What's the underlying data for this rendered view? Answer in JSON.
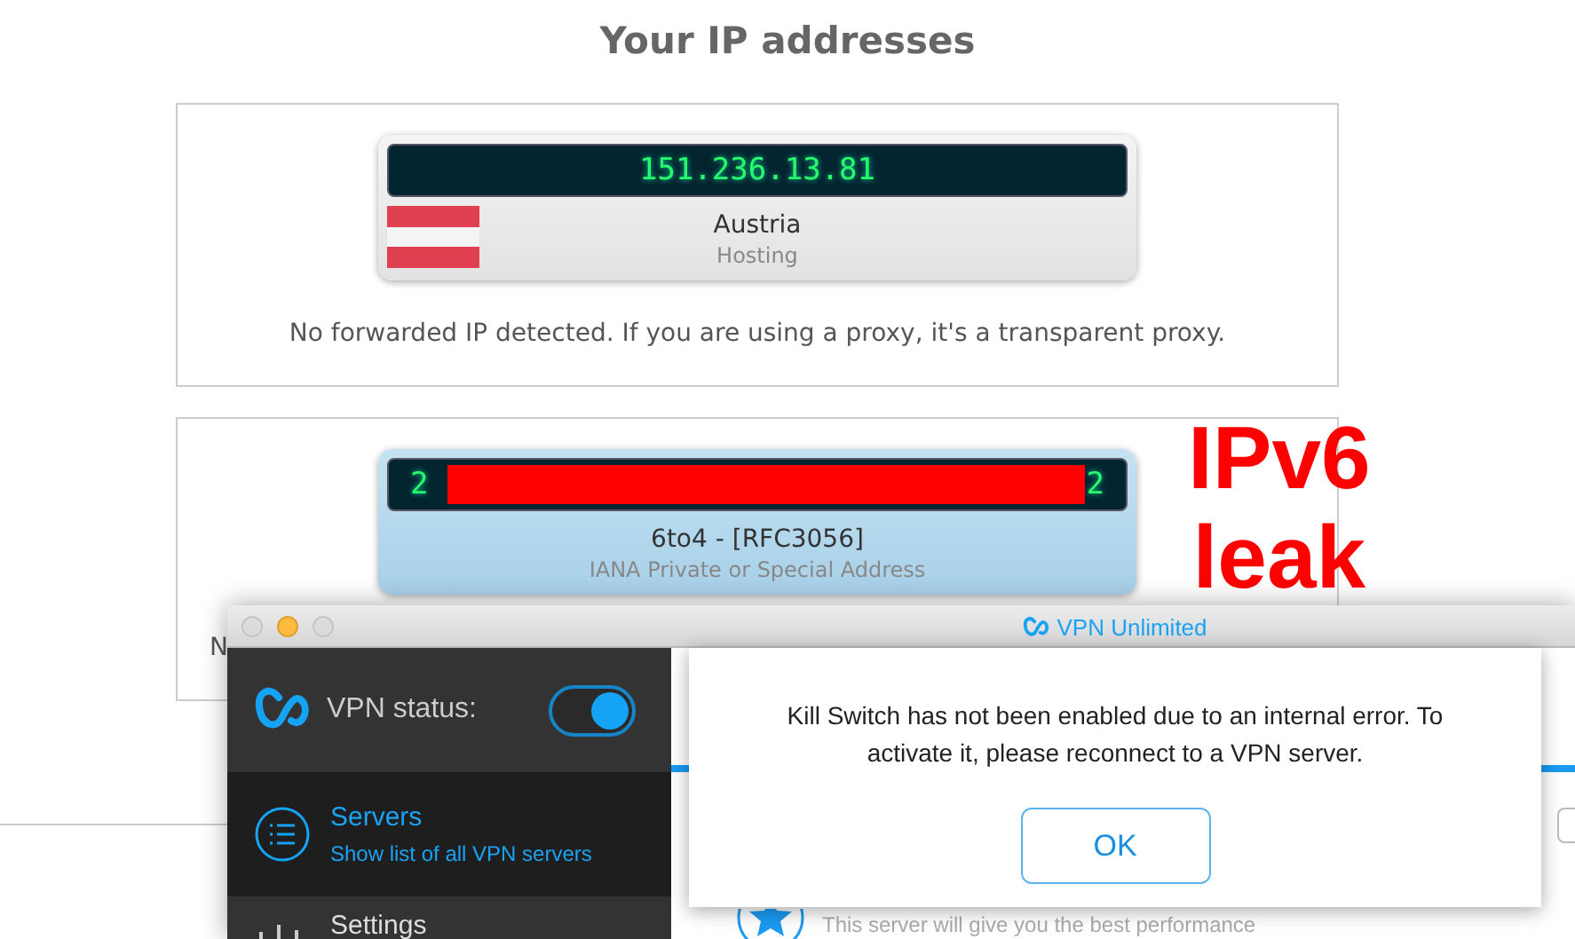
{
  "page": {
    "title": "Your IP addresses"
  },
  "addresses": [
    {
      "ip": "151.236.13.81",
      "redacted": false,
      "flag": true,
      "country": "Austria",
      "type": "Hosting",
      "highlighted": false,
      "note": "No forwarded IP detected. If you are using a proxy, it's a transparent proxy."
    },
    {
      "ip_start": "2",
      "ip_end": "2",
      "redacted": true,
      "country": "6to4 - [RFC3056]",
      "type": "IANA Private or Special Address",
      "highlighted": true,
      "note": "N"
    }
  ],
  "annotation": {
    "lines": [
      "IPv6",
      "leak"
    ]
  },
  "vpn_window": {
    "title": "VPN Unlimited",
    "status_label": "VPN status:",
    "vpn_on": true,
    "menu": [
      {
        "kind": "servers",
        "title": "Servers",
        "subtitle": "Show list of all VPN servers",
        "selected": true
      },
      {
        "kind": "settings",
        "title": "Settings",
        "selected": false
      }
    ],
    "server_hint": "This server will give you the best performance",
    "dialog": {
      "message": "Kill Switch has not been enabled due to an internal error. To activate it, please reconnect to a VPN server.",
      "button": "OK"
    }
  }
}
